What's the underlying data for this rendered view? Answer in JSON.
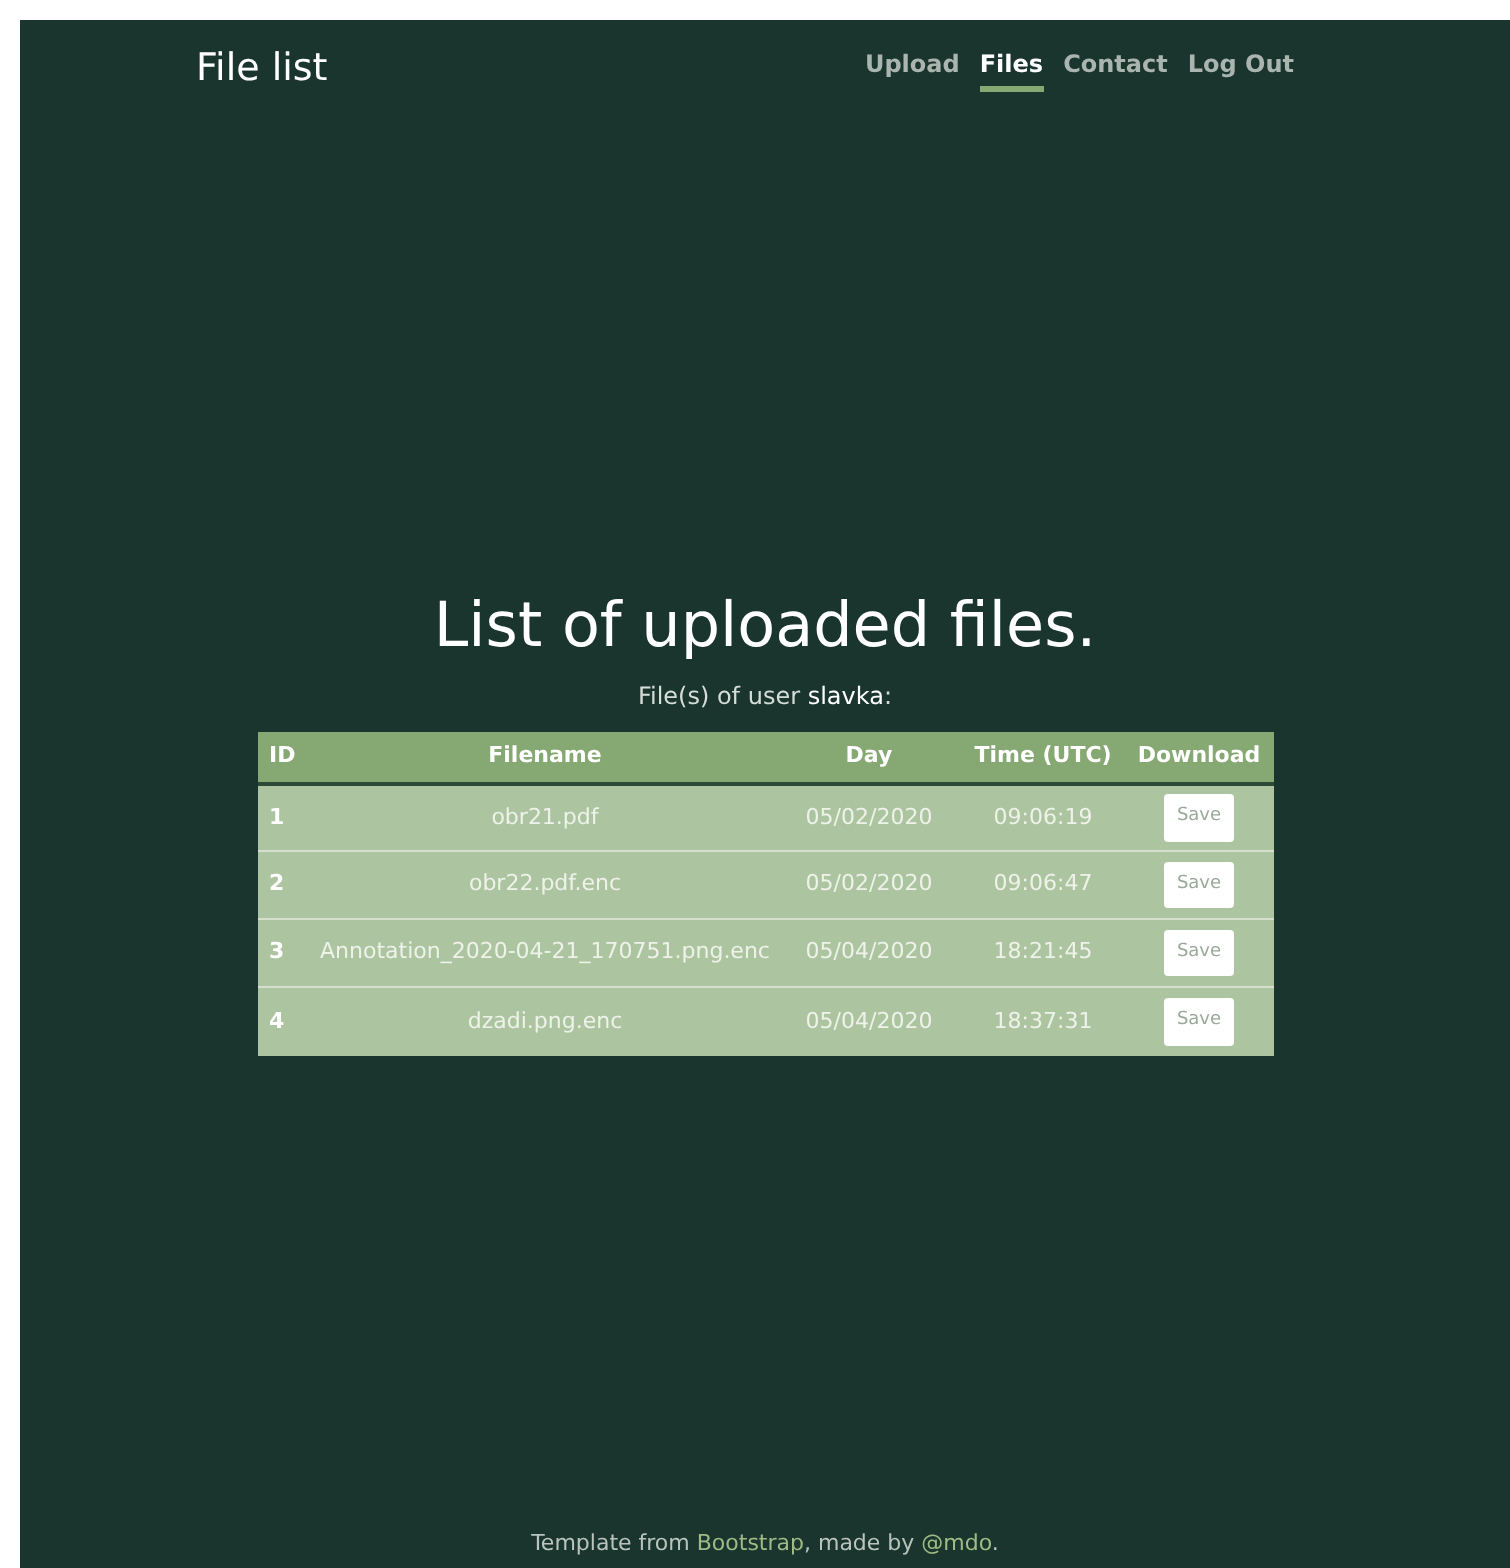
{
  "brand": "File list",
  "nav": [
    {
      "label": "Upload",
      "selected": false
    },
    {
      "label": "Files",
      "selected": true
    },
    {
      "label": "Contact",
      "selected": false
    },
    {
      "label": "Log Out",
      "selected": false
    }
  ],
  "heading": "List of uploaded files.",
  "subtitle": "File(s) of user **slavka**:",
  "table": {
    "columns": [
      "ID",
      "Filename",
      "Day",
      "Time (UTC)",
      "Download"
    ],
    "rows": [
      {
        "id": "1",
        "filename": "obr21.pdf",
        "day": "05/02/2020",
        "time": "09:06:19",
        "action": "Save"
      },
      {
        "id": "2",
        "filename": "obr22.pdf.enc",
        "day": "05/02/2020",
        "time": "09:06:47",
        "action": "Save"
      },
      {
        "id": "3",
        "filename": "Annotation_2020-04-21_170751.png.enc",
        "day": "05/04/2020",
        "time": "18:21:45",
        "action": "Save"
      },
      {
        "id": "4",
        "filename": "dzadi.png.enc",
        "day": "05/04/2020",
        "time": "18:37:31",
        "action": "Save"
      }
    ]
  },
  "footer": {
    "before": "Template from ",
    "link1": "Bootstrap",
    "middle": ", made by ",
    "link2": "@mdo",
    "after": "."
  }
}
